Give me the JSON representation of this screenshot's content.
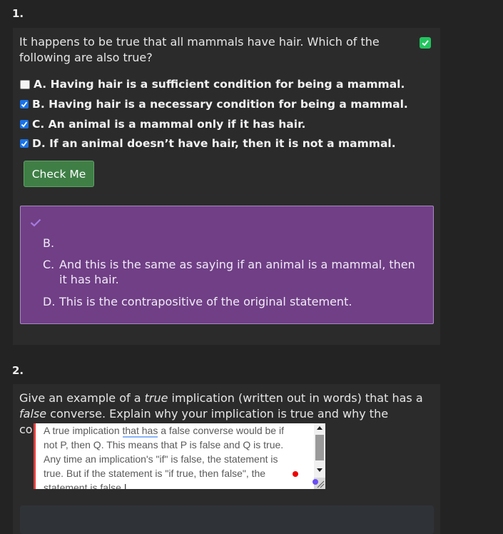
{
  "q1": {
    "number": "1.",
    "prompt": "It happens to be true that all mammals have hair. Which of the following are also true?",
    "correct_badge_icon": "checkmark-icon",
    "options": [
      {
        "label": "A. Having hair is a sufficient condition for being a mammal.",
        "checked": false
      },
      {
        "label": "B. Having hair is a necessary condition for being a mammal.",
        "checked": true
      },
      {
        "label": "C. An animal is a mammal only if it has hair.",
        "checked": true
      },
      {
        "label": "D. If an animal doesn’t have hair, then it is not a mammal.",
        "checked": true
      }
    ],
    "check_button": "Check Me",
    "feedback": {
      "items": [
        {
          "letter": "B.",
          "text": ""
        },
        {
          "letter": "C.",
          "text": "And this is the same as saying if an animal is a mammal, then it has hair."
        },
        {
          "letter": "D.",
          "text": "This is the contrapositive of the original statement."
        }
      ]
    }
  },
  "q2": {
    "number": "2.",
    "prompt_pre": "Give an example of a ",
    "prompt_em1": "true",
    "prompt_mid": " implication (written out in words) that has a ",
    "prompt_em2": "false",
    "prompt_post": " converse. Explain why your implication is true and why the converse is false.",
    "answer_pre": "A true implication ",
    "answer_underlined": "that has",
    "answer_post": " a false converse would be if not P, then Q. This means that P is false and Q is true. Any time an implication's \"if\" is false, the statement is true. But if the statement is \"if true, then false\", the statement is false."
  },
  "colors": {
    "background": "#232323",
    "card": "#2b2b2b",
    "badge": "#22c55e",
    "check_button": "#3f7f46",
    "feedback": "#703f86",
    "checkbox": "#1a73e8"
  }
}
